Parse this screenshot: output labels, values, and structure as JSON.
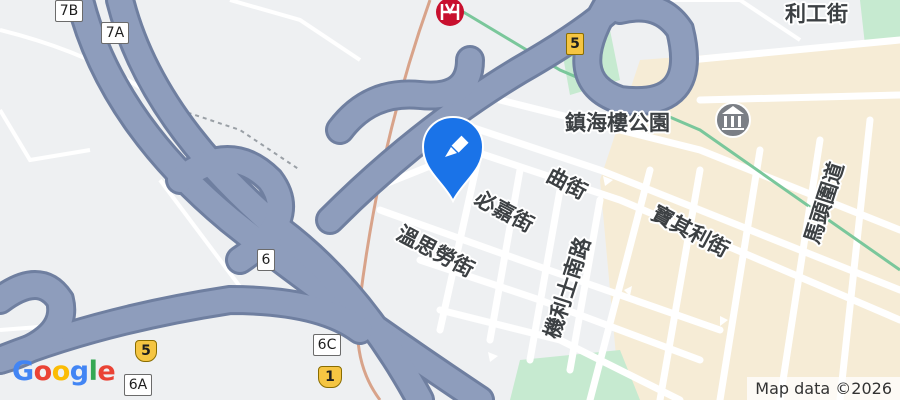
{
  "map": {
    "place_labels": {
      "lei_kung_street": "利工街",
      "chun_hoi_building_park": "鎮海樓公園",
      "bulkeley_street": "必嘉街",
      "gillies_avenue": "曲街",
      "wuhu_street": "溫思勞街",
      "ki_lung_south_road": "機利士南路",
      "baker_street": "寶其利街",
      "ma_tau_wai_road": "馬頭圍道"
    },
    "route_shields": {
      "exit_7b": "7B",
      "exit_7a": "7A",
      "exit_6": "6",
      "exit_6c": "6C",
      "exit_6a": "6A",
      "route_5_top": "5",
      "route_5_bottom": "5",
      "route_1": "1"
    },
    "metro_icon": "mtr-station-icon",
    "park_icon": "museum-icon",
    "pin_icon": "location-pin-icon",
    "attribution": "Map data ©2026",
    "logo_text": "Google",
    "colors": {
      "highway": "#8e9dbc",
      "highway_outline": "#6f7fa0",
      "street": "#ffffff",
      "background": "#eef0f2",
      "park": "#c6ead0",
      "urban_beige": "#f6ecd6",
      "pin": "#1a73e8",
      "mtr": "#c8102e",
      "rail": "#d8a38a",
      "rail_green": "#7ac79b",
      "shield_yellow": "#f5c542"
    }
  }
}
